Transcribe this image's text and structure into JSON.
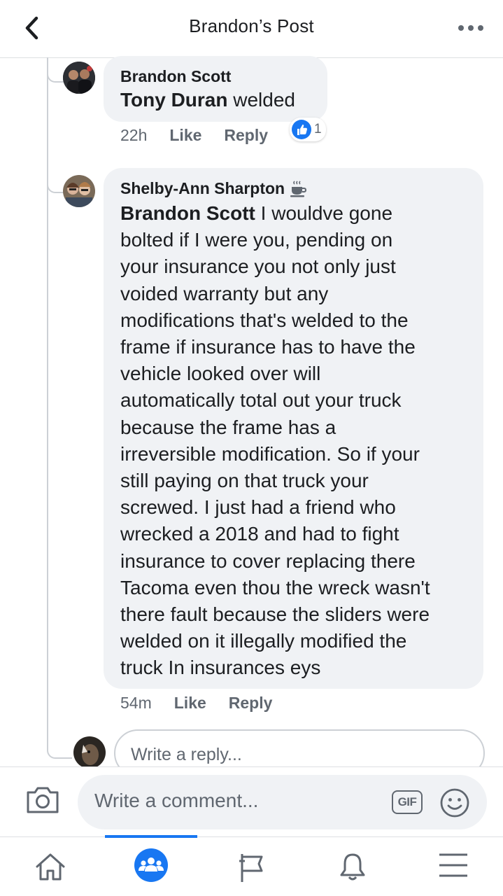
{
  "header": {
    "title": "Brandon’s Post"
  },
  "comments": [
    {
      "author": "Brandon Scott",
      "mention": "Tony Duran",
      "text": " welded",
      "time": "22h",
      "like_label": "Like",
      "reply_label": "Reply",
      "reaction_count": "1"
    },
    {
      "author": "Shelby-Ann Sharpton",
      "author_badge": "coffee-icon",
      "mention": "Brandon Scott",
      "text_lines": [
        " I wouldve gone",
        "bolted if I were you, pending on",
        "your insurance you not only  just",
        "voided warranty but any",
        "modifications that's welded to the",
        "frame if insurance has to have the",
        "vehicle looked over will",
        "automatically total out your truck",
        "because the frame has a",
        "irreversible modification.  So if your",
        "still paying on that truck your",
        "screwed. I just had a friend who",
        "wrecked a 2018 and had to fight",
        "insurance to cover replacing there",
        "Tacoma even thou the wreck wasn't",
        "there fault because the sliders were",
        "welded on it illegally modified the",
        "truck In insurances eys"
      ],
      "time": "54m",
      "like_label": "Like",
      "reply_label": "Reply"
    }
  ],
  "reply_box": {
    "placeholder": "Write a reply..."
  },
  "composer": {
    "placeholder": "Write a comment...",
    "gif_label": "GIF"
  },
  "tabs": [
    {
      "icon": "home-icon",
      "active": false
    },
    {
      "icon": "groups-icon",
      "active": true
    },
    {
      "icon": "pages-flag-icon",
      "active": false
    },
    {
      "icon": "notifications-bell-icon",
      "active": false
    },
    {
      "icon": "menu-icon",
      "active": false
    }
  ],
  "colors": {
    "accent": "#1877f2",
    "bubble": "#f0f2f5",
    "meta": "#606770"
  }
}
